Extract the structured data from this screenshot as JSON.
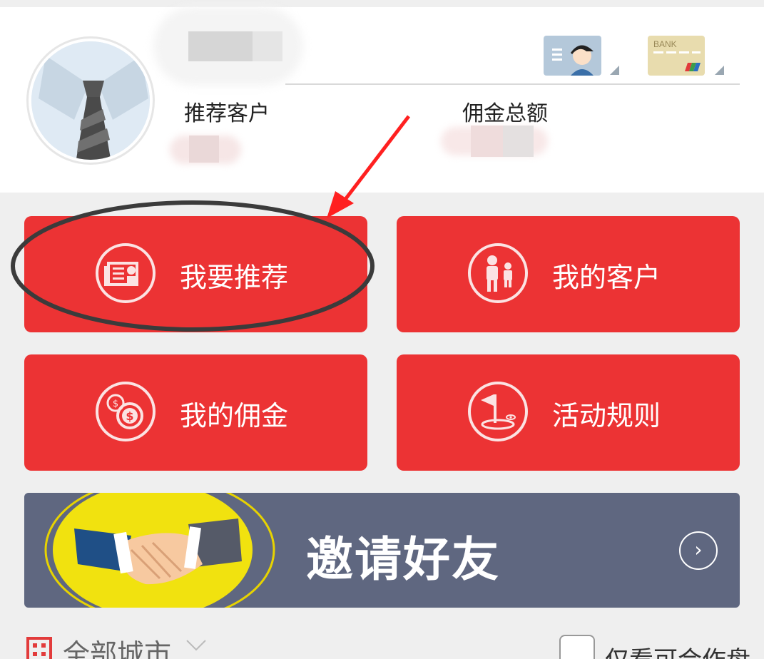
{
  "profile": {
    "stats": [
      {
        "label": "推荐客户"
      },
      {
        "label": "佣金总额"
      }
    ],
    "id_card_icon": "id-card-icon",
    "bank_card": {
      "icon": "bank-card-icon",
      "text": "BANK"
    }
  },
  "tiles": [
    {
      "label": "我要推荐",
      "icon": "recommend-icon"
    },
    {
      "label": "我的客户",
      "icon": "customers-icon"
    },
    {
      "label": "我的佣金",
      "icon": "commission-icon"
    },
    {
      "label": "活动规则",
      "icon": "rules-flag-icon"
    }
  ],
  "banner": {
    "title": "邀请好友",
    "icon": "handshake-icon"
  },
  "filter": {
    "city": "全部城市",
    "cooperation_only": "仅看可合作盘"
  },
  "colors": {
    "accent": "#ec3334",
    "banner_bg": "#5f6780",
    "page_bg": "#efefef",
    "annotation": "#ff2020"
  }
}
